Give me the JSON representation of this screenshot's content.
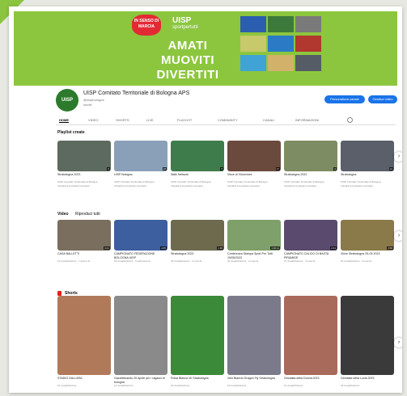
{
  "banner": {
    "heart_text": "IN SENSO DI MARCIA",
    "logo": "UISP",
    "logo_sub": "sportpertutti",
    "slogans": [
      "AMATI",
      "MUOVITI",
      "DIVERTITI"
    ]
  },
  "channel": {
    "avatar_text": "UISP",
    "name": "UISP Comitato Territoriale di Bologna APS",
    "handle": "@uispbologna",
    "subs": "Iscritti",
    "btn_customize": "Personalizza canale",
    "btn_manage": "Gestisci video"
  },
  "tabs": [
    "HOME",
    "VIDEO",
    "SHORTS",
    "LIVE",
    "PLAYLIST",
    "COMMUNITY",
    "CANALI",
    "INFORMAZIONI"
  ],
  "sections": {
    "playlists": "Playlist create",
    "videos": "Video",
    "videos_play": "Riproduci tutti",
    "shorts": "Shorts"
  },
  "playlist_cards": [
    {
      "title": "Strabologna 2023",
      "meta": "UISP Comitato Territoriale di Bologna",
      "meta2": "Visualizza la playlist completa",
      "count": "6",
      "color": "#5d6a5f"
    },
    {
      "title": "UISP Bologna",
      "meta": "UISP Comitato Territoriale di Bologna",
      "meta2": "Visualizza la playlist completa",
      "count": "18",
      "color": "#8aa0b8"
    },
    {
      "title": "Walk Network",
      "meta": "UISP Comitato Territoriale di Bologna",
      "meta2": "Visualizza la playlist completa",
      "count": "5",
      "color": "#3f7c4c"
    },
    {
      "title": "Vince di Vincennes",
      "meta": "UISP Comitato Territoriale di Bologna",
      "meta2": "Visualizza la playlist completa",
      "count": "17",
      "color": "#6b4a3e"
    },
    {
      "title": "Strabologna 2022",
      "meta": "UISP Comitato Territoriale di Bologna",
      "meta2": "Visualizza la playlist completa",
      "count": "9",
      "color": "#7d8c62"
    },
    {
      "title": "Strabologna",
      "meta": "UISP Comitato Territoriale di Bologna",
      "meta2": "Visualizza la playlist completa",
      "count": "12",
      "color": "#5a5f6a"
    }
  ],
  "video_cards": [
    {
      "title": "CASA BALLETTI",
      "meta": "21 visualizzazioni · 1 giorno fa",
      "dur": "3:21",
      "color": "#7a6e5e"
    },
    {
      "title": "CAMPIONATO FEDERAZIONE BOLOGNA UISP",
      "meta": "18 visualizzazioni · 3 settimane fa",
      "dur": "4:05",
      "color": "#3d5fa0"
    },
    {
      "title": "Strabologna 2023",
      "meta": "45 visualizzazioni · 2 mesi fa",
      "dur": "1:38",
      "color": "#6e6a4e"
    },
    {
      "title": "Conferenza Stampa Sport Per Tutti · 19/05/2023",
      "meta": "32 visualizzazioni · 2 mesi fa",
      "dur": "1:02:11",
      "color": "#7fa06a"
    },
    {
      "title": "CAMPIONATO CALCIO DI BASTA PIRAMIDE",
      "meta": "27 visualizzazioni · 3 mesi fa",
      "dur": "2:44",
      "color": "#5a4a6e"
    },
    {
      "title": "Vince Strabologna 25-05 2023",
      "meta": "20 visualizzazioni · 3 mesi fa",
      "dur": "0:58",
      "color": "#8a7a4a"
    }
  ],
  "short_cards": [
    {
      "title": "STADIO DALLARA",
      "meta": "21 visualizzazioni",
      "color": "#b07a5a"
    },
    {
      "title": "Gazzettinando 25 Aprile per i ragazzi di bologna",
      "meta": "14 visualizzazioni",
      "color": "#8a8a8a"
    },
    {
      "title": "Polsa Bianca Vir Strabologna",
      "meta": "19 visualizzazioni",
      "color": "#3a8a3a"
    },
    {
      "title": "Velo Bianchi Dragon Fly Strabologna",
      "meta": "16 visualizzazioni",
      "color": "#7a7a8a"
    },
    {
      "title": "Ginnasta della Donna 2023",
      "meta": "21 visualizzazioni",
      "color": "#a86a5a"
    },
    {
      "title": "Ginnasta della Lucia 2023",
      "meta": "18 visualizzazioni",
      "color": "#3a3a3a"
    }
  ]
}
